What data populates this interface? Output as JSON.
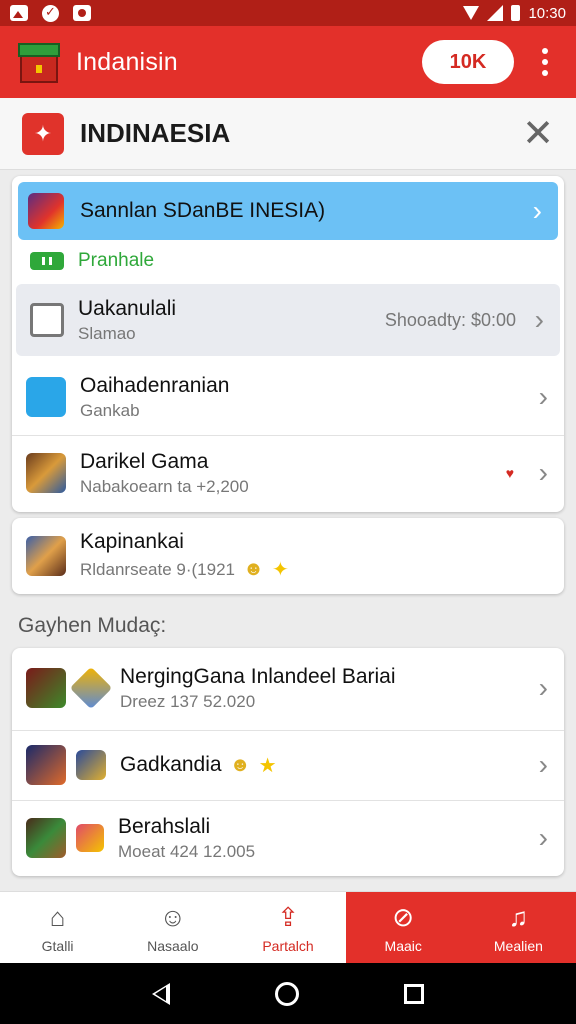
{
  "status_bar": {
    "time": "10:30"
  },
  "app_bar": {
    "title": "Indanisin",
    "counter": "10K"
  },
  "sub_header": {
    "title": "INDINAESIA"
  },
  "top_card": {
    "highlight": {
      "title": "Sannlan SDanBE INESIA)"
    },
    "badge_label": "Pranhale",
    "selected": {
      "title": "Uakanulali",
      "subtitle": "Slamao",
      "right_text": "Shooadty: $0:00"
    },
    "items": [
      {
        "title": "Oaihadenranian",
        "subtitle": "Gankab"
      },
      {
        "title": "Darikel Gama",
        "subtitle": "Nabakoearn ta +2,200"
      }
    ]
  },
  "single_card": {
    "title": "Kapinankai",
    "subtitle": "Rldanrseate 9·(1921"
  },
  "section_label": "Gayhen Mudaç:",
  "bottom_list": [
    {
      "title": "NergingGana Inlandeel Bariai",
      "subtitle": "Dreez 137 52.020"
    },
    {
      "title": "Gadkandia"
    },
    {
      "title": "Berahslali",
      "subtitle": "Moeat 424 12.005"
    }
  ],
  "bottom_nav": [
    {
      "label": "Gtalli",
      "icon": "home-icon"
    },
    {
      "label": "Nasaalo",
      "icon": "face-icon"
    },
    {
      "label": "Partalch",
      "icon": "upload-icon"
    },
    {
      "label": "Maaic",
      "icon": "no-sign-icon"
    },
    {
      "label": "Mealien",
      "icon": "bell-icon"
    }
  ],
  "colors": {
    "primary": "#e3302a",
    "highlight_row": "#6cc1f5",
    "badge": "#2fa83a"
  }
}
